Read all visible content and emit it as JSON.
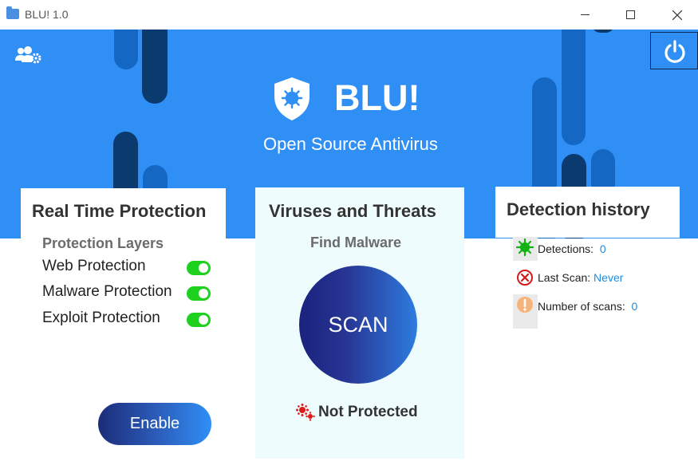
{
  "window": {
    "title": "BLU! 1.0",
    "controls": [
      "minimize",
      "maximize",
      "close"
    ]
  },
  "header": {
    "brand": "BLU!",
    "subtitle": "Open Source Antivirus",
    "icons": {
      "users_settings": "users-gear-icon",
      "shield": "shield-virus-icon",
      "power": "power-icon"
    }
  },
  "real_time_protection": {
    "title": "Real Time Protection",
    "subtitle": "Protection Layers",
    "layers": [
      {
        "label": "Web Protection",
        "enabled": true
      },
      {
        "label": "Malware Protection",
        "enabled": true
      },
      {
        "label": "Exploit Protection",
        "enabled": true
      }
    ],
    "enable_button": "Enable"
  },
  "viruses_threats": {
    "title": "Viruses and Threats",
    "subtitle": "Find Malware",
    "scan_button": "SCAN",
    "status": "Not Protected"
  },
  "detection_history": {
    "title": "Detection history",
    "items": [
      {
        "label": "Detections:",
        "value": "0",
        "icon": "virus-icon"
      },
      {
        "label": "Last Scan:",
        "value": "Never",
        "icon": "error-icon"
      },
      {
        "label": "Number of scans:",
        "value": "0",
        "icon": "warning-icon"
      }
    ]
  },
  "colors": {
    "banner": "#2f8ff5",
    "toggle_on": "#1fd01f",
    "link_value": "#1e8be0",
    "panel_mid_bg": "#effcfd"
  }
}
